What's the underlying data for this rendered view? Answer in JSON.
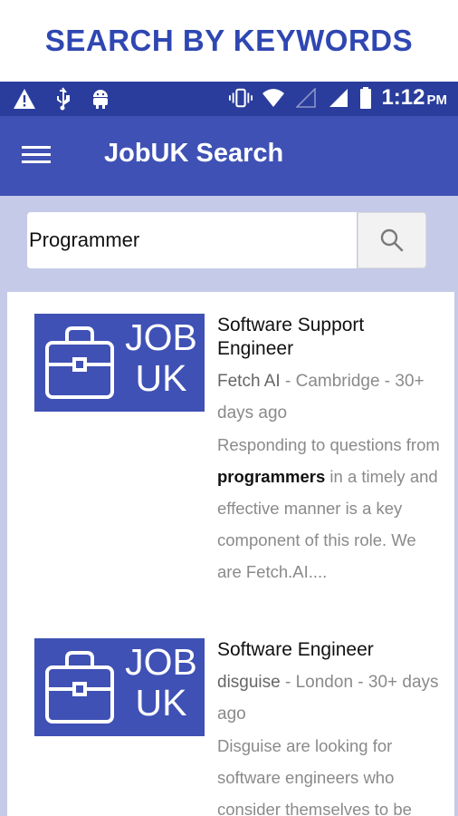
{
  "banner": {
    "text": "SEARCH BY KEYWORDS"
  },
  "statusbar": {
    "time": "1:12",
    "ampm": "PM",
    "left_icons": [
      "warning-icon",
      "usb-icon",
      "android-icon"
    ],
    "right_icons": [
      "vibrate-icon",
      "wifi-icon",
      "no-signal-icon",
      "signal-icon",
      "battery-icon"
    ]
  },
  "appbar": {
    "title": "JobUK Search",
    "menu_icon": "hamburger-menu-icon"
  },
  "search": {
    "value": "Programmer",
    "button_icon": "search-icon"
  },
  "colors": {
    "primary": "#3f51b5",
    "primary_dark": "#2a3d9c",
    "banner_text": "#2f47b2",
    "search_bg": "#c5cae9"
  },
  "logo": {
    "line1": "JOB",
    "line2": "UK",
    "icon": "briefcase-icon"
  },
  "jobs": [
    {
      "title": "Software Support Engineer",
      "company": "Fetch AI",
      "sep1": " - ",
      "location": "Cambridge",
      "sep2": " - ",
      "age": "30+ days ago",
      "desc_before": "Responding to questions from ",
      "desc_keyword": "programmers",
      "desc_after": " in a timely and effective manner is a key component of this role. We are Fetch.AI...."
    },
    {
      "title": "Software Engineer",
      "company": "disguise",
      "sep1": " - ",
      "location": "London",
      "sep2": " - ",
      "age": "30+ days ago",
      "desc_before": "Disguise are looking for software engineers who consider themselves to be",
      "desc_keyword": "",
      "desc_after": ""
    }
  ]
}
